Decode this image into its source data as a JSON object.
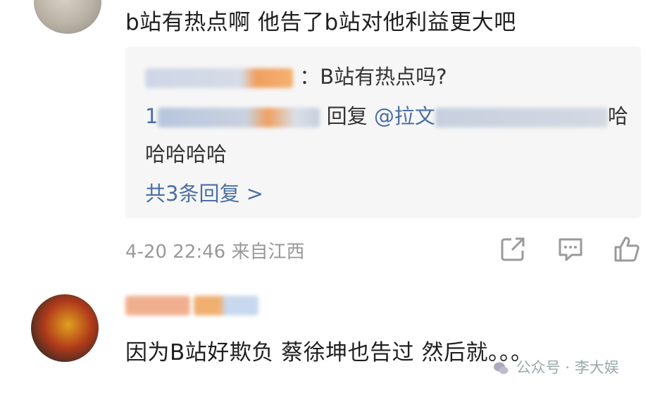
{
  "comment1": {
    "text": "b站有热点啊 他告了b站对他利益更大吧",
    "reply_box": {
      "reply1_text": "：B站有热点吗?",
      "reply2_prefix": "1",
      "reply2_label": "回复",
      "reply2_mention": "@拉文",
      "reply2_tail": "哈",
      "reply2_cont": "哈哈哈哈",
      "more_replies": "共3条回复 >"
    },
    "meta": "4-20 22:46 来自江西"
  },
  "comment2": {
    "text": "因为B站好欺负  蔡徐坤也告过 然后就。。。"
  },
  "watermark": "公众号 · 李大娱",
  "colors": {
    "link": "#4a6fa5",
    "meta": "#999999",
    "reply_bg": "#f6f6f6"
  },
  "icons": [
    "share-icon",
    "comment-icon",
    "like-icon",
    "wechat-icon"
  ]
}
